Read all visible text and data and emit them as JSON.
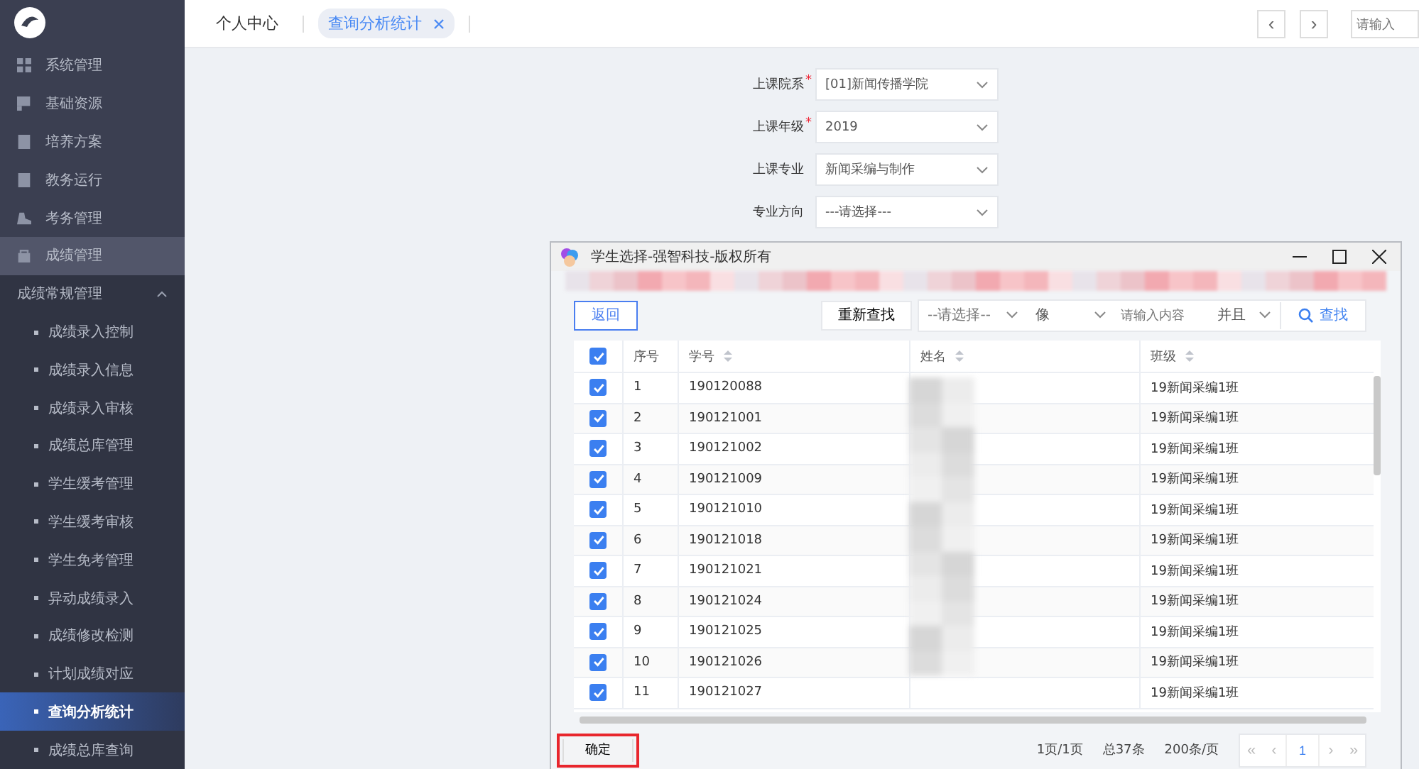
{
  "sidebar": {
    "items": [
      {
        "label": "系统管理",
        "selected": false
      },
      {
        "label": "基础资源",
        "selected": false
      },
      {
        "label": "培养方案",
        "selected": false
      },
      {
        "label": "教务运行",
        "selected": false
      },
      {
        "label": "考务管理",
        "selected": false
      },
      {
        "label": "成绩管理",
        "selected": true
      }
    ],
    "group": {
      "label": "成绩常规管理",
      "expanded": true,
      "children": [
        {
          "label": "成绩录入控制",
          "selected": false
        },
        {
          "label": "成绩录入信息",
          "selected": false
        },
        {
          "label": "成绩录入审核",
          "selected": false
        },
        {
          "label": "成绩总库管理",
          "selected": false
        },
        {
          "label": "学生缓考管理",
          "selected": false
        },
        {
          "label": "学生缓考审核",
          "selected": false
        },
        {
          "label": "学生免考管理",
          "selected": false
        },
        {
          "label": "异动成绩录入",
          "selected": false
        },
        {
          "label": "成绩修改检测",
          "selected": false
        },
        {
          "label": "计划成绩对应",
          "selected": false
        },
        {
          "label": "查询分析统计",
          "selected": true
        },
        {
          "label": "成绩总库查询",
          "selected": false
        }
      ]
    }
  },
  "tabs": [
    {
      "label": "个人中心",
      "selected": false,
      "closable": false
    },
    {
      "label": "查询分析统计",
      "selected": true,
      "closable": true
    }
  ],
  "header": {
    "prev": "‹",
    "next": "›",
    "search_placeholder": "请输入"
  },
  "form": [
    {
      "label": "上课院系",
      "required_mark": "*",
      "value": "[01]新闻传播学院"
    },
    {
      "label": "上课年级",
      "required_mark": "*",
      "value": "2019"
    },
    {
      "label": "上课专业",
      "value": "新闻采编与制作"
    },
    {
      "label": "专业方向",
      "value": "---请选择---"
    }
  ],
  "dialog": {
    "title": "学生选择-强智科技-版权所有",
    "back": "返回",
    "reset": "重新查找",
    "field_select": "--请选择--",
    "op_select": "像",
    "input_placeholder": "请输入内容",
    "logic_select": "并且",
    "search": "查找",
    "table": {
      "columns": [
        "序号",
        "学号",
        "姓名",
        "班级"
      ],
      "all_checked": true,
      "rows": [
        {
          "checked": true,
          "no": "1",
          "id": "190120088",
          "class": "19新闻采编1班"
        },
        {
          "checked": true,
          "no": "2",
          "id": "190121001",
          "class": "19新闻采编1班"
        },
        {
          "checked": true,
          "no": "3",
          "id": "190121002",
          "class": "19新闻采编1班"
        },
        {
          "checked": true,
          "no": "4",
          "id": "190121009",
          "class": "19新闻采编1班"
        },
        {
          "checked": true,
          "no": "5",
          "id": "190121010",
          "class": "19新闻采编1班"
        },
        {
          "checked": true,
          "no": "6",
          "id": "190121018",
          "class": "19新闻采编1班"
        },
        {
          "checked": true,
          "no": "7",
          "id": "190121021",
          "class": "19新闻采编1班"
        },
        {
          "checked": true,
          "no": "8",
          "id": "190121024",
          "class": "19新闻采编1班"
        },
        {
          "checked": true,
          "no": "9",
          "id": "190121025",
          "class": "19新闻采编1班"
        },
        {
          "checked": true,
          "no": "10",
          "id": "190121026",
          "class": "19新闻采编1班"
        },
        {
          "checked": true,
          "no": "11",
          "id": "190121027",
          "class": "19新闻采编1班"
        }
      ]
    },
    "confirm": "确定",
    "pages": "1页/1页",
    "total": "总37条",
    "per_page": "200条/页",
    "pager": {
      "first": "«",
      "prev": "‹",
      "current": "1",
      "next": "›",
      "last": "»"
    }
  }
}
